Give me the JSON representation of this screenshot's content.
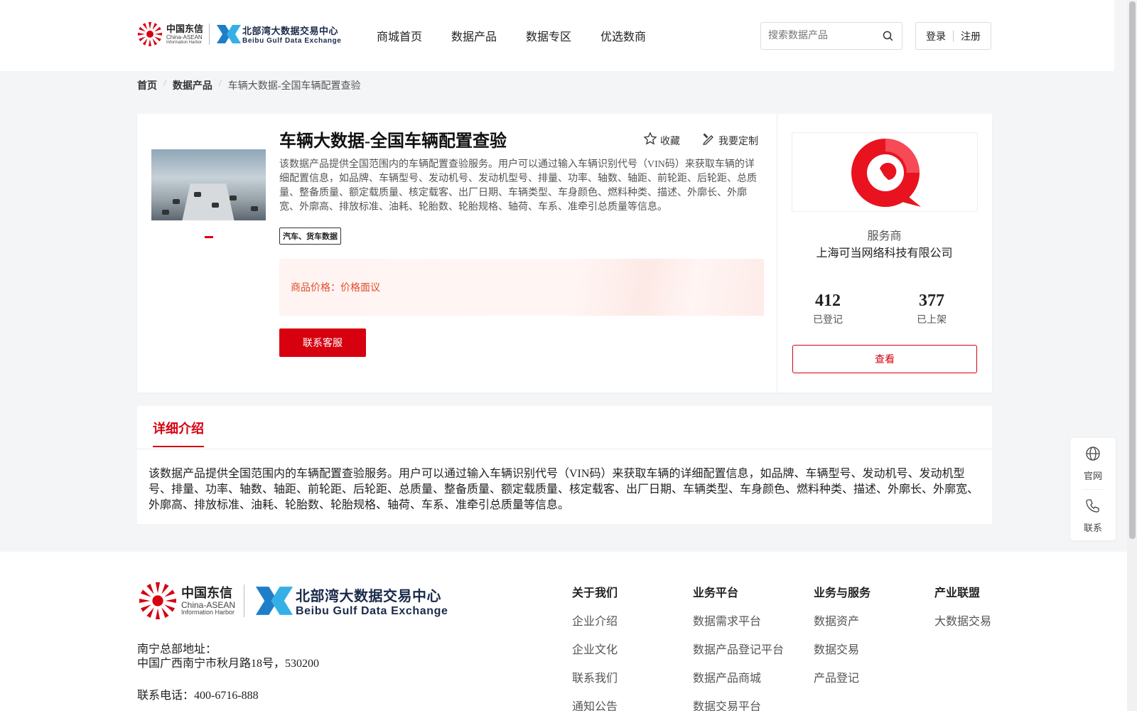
{
  "header": {
    "logo": {
      "cn": "中国东信",
      "en": "China-ASEAN",
      "sub": "Information Harbor",
      "bb_cn": "北部湾大数据交易中心",
      "bb_en": "Beibu Gulf Data Exchange"
    },
    "nav": [
      "商城首页",
      "数据产品",
      "数据专区",
      "优选数商"
    ],
    "search_placeholder": "搜索数据产品",
    "login": "登录",
    "register": "注册"
  },
  "breadcrumb": {
    "home": "首页",
    "section": "数据产品",
    "current": "车辆大数据-全国车辆配置查验",
    "separator": "/"
  },
  "product": {
    "title": "车辆大数据-全国车辆配置查验",
    "favorite": "收藏",
    "customize": "我要定制",
    "description": "该数据产品提供全国范围内的车辆配置查验服务。用户可以通过输入车辆识别代号（VIN码）来获取车辆的详细配置信息，如品牌、车辆型号、发动机号、发动机型号、排量、功率、轴数、轴距、前轮距、后轮距、总质量、整备质量、额定载质量、核定载客、出厂日期、车辆类型、车身颜色、燃料种类、描述、外廓长、外廓宽、外廓高、排放标准、油耗、轮胎数、轮胎规格、轴荷、车系、准牵引总质量等信息。",
    "tag": "汽车、货车数据",
    "price": "商品价格：价格面议",
    "contact_button": "联系客服"
  },
  "provider": {
    "label": "服务商",
    "name": "上海可当网络科技有限公司",
    "registered_count": "412",
    "registered_label": "已登记",
    "listed_count": "377",
    "listed_label": "已上架",
    "view_button": "查看"
  },
  "detail": {
    "tab": "详细介绍",
    "text": "该数据产品提供全国范围内的车辆配置查验服务。用户可以通过输入车辆识别代号（VIN码）来获取车辆的详细配置信息，如品牌、车辆型号、发动机号、发动机型号、排量、功率、轴数、轴距、前轮距、后轮距、总质量、整备质量、额定载质量、核定载客、出厂日期、车辆类型、车身颜色、燃料种类、描述、外廓长、外廓宽、外廓高、排放标准、油耗、轮胎数、轮胎规格、轴荷、车系、准牵引总质量等信息。"
  },
  "side": {
    "website": "官网",
    "contact": "联系"
  },
  "footer": {
    "address_label": "南宁总部地址：",
    "address": "中国广西南宁市秋月路18号，530200",
    "phone": "联系电话：400-6716-888",
    "columns": [
      {
        "title": "关于我们",
        "items": [
          "企业介绍",
          "企业文化",
          "联系我们",
          "通知公告"
        ]
      },
      {
        "title": "业务平台",
        "items": [
          "数据需求平台",
          "数据产品登记平台",
          "数据产品商城",
          "数据交易平台"
        ]
      },
      {
        "title": "业务与服务",
        "items": [
          "数据资产",
          "数据交易",
          "产品登记"
        ]
      },
      {
        "title": "产业联盟",
        "items": [
          "大数据交易"
        ]
      }
    ]
  },
  "colors": {
    "accent": "#d6000f",
    "price": "#e14b2d"
  },
  "icons": [
    "search-icon",
    "star-icon",
    "customize-icon",
    "globe-icon",
    "phone-icon"
  ]
}
